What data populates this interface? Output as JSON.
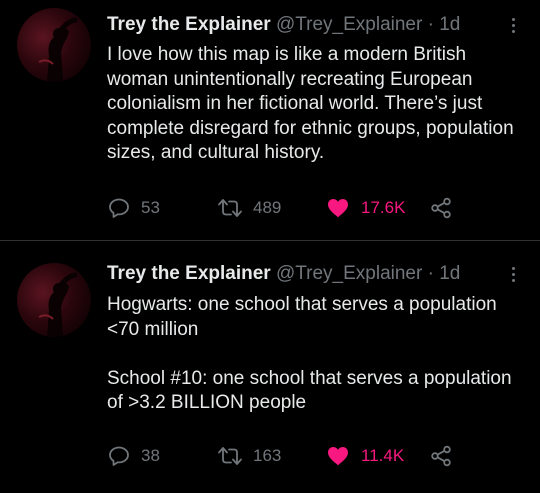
{
  "tweets": [
    {
      "author_name": "Trey the Explainer",
      "handle": "@Trey_Explainer",
      "separator": "·",
      "time": "1d",
      "text": "I love how this map is like a modern British woman unintentionally recreating European colonialism in her fictional world. There’s just complete disregard for ethnic groups, population sizes, and cultural history.",
      "reply_count": "53",
      "retweet_count": "489",
      "like_count": "17.6K",
      "liked": true
    },
    {
      "author_name": "Trey the Explainer",
      "handle": "@Trey_Explainer",
      "separator": "·",
      "time": "1d",
      "text": "Hogwarts: one school that serves a population <70 million\n\nSchool #10: one school that serves a population of >3.2 BILLION people",
      "reply_count": "38",
      "retweet_count": "163",
      "like_count": "11.4K",
      "liked": true
    }
  ],
  "icons": {
    "reply": "reply-icon",
    "retweet": "retweet-icon",
    "like": "heart-icon",
    "share": "share-icon",
    "more": "more-options-icon"
  },
  "colors": {
    "background": "#000000",
    "text": "#e7e9ea",
    "muted": "#71767b",
    "like": "#f91880",
    "divider": "#2f3336"
  }
}
